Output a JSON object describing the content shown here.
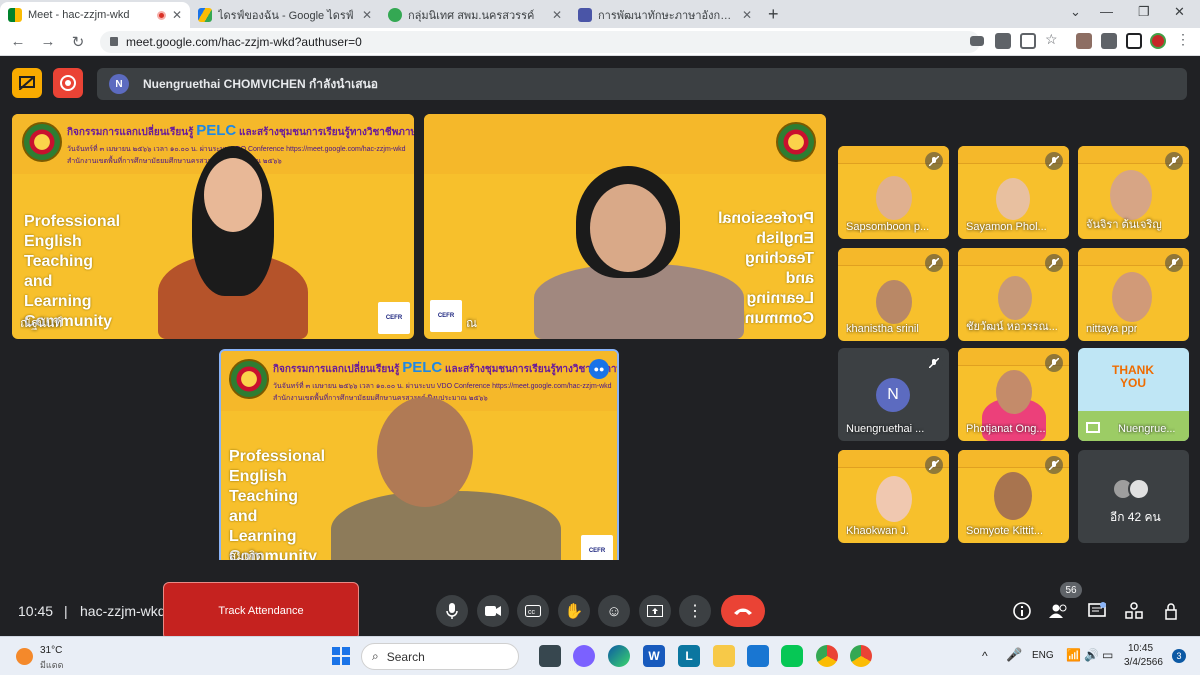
{
  "browser": {
    "tabs": [
      {
        "title": "Meet - hac-zzjm-wkd",
        "active": true,
        "recording": true,
        "favicon": "google-meet-icon"
      },
      {
        "title": "ไดรฟ์ของฉัน - Google ไดรฟ์",
        "active": false,
        "favicon": "google-drive-icon"
      },
      {
        "title": "กลุ่มนิเทศ สพม.นครสวรรค์",
        "active": false,
        "favicon": "web-icon"
      },
      {
        "title": "การพัฒนาทักษะภาษาอังกฤษ English",
        "active": false,
        "favicon": "google-forms-icon"
      }
    ],
    "url": "meet.google.com/hac-zzjm-wkd?authuser=0"
  },
  "meet": {
    "presenter_initial": "N",
    "presenter_text": "Nuengruethai CHOMVICHEN กำลังนำเสนอ",
    "banner": {
      "title_prefix": "กิจกรรมการแลกเปลี่ยนเรียนรู้",
      "pelc": "PELC",
      "title_suffix": "และสร้างชุมชนการเรียนรู้ทางวิชาชีพภาษาอังกฤษ",
      "line2": "วันจันทร์ที่ ๓ เมษายน ๒๕๖๖ เวลา ๑๐.๐๐ น. ผ่านระบบ VDO Conference https://meet.google.com/hac-zzjm-wkd",
      "line3": "สำนักงานเขตพื้นที่การศึกษามัธยมศึกษานครสวรรค์ ปีงบประมาณ ๒๕๖๖"
    },
    "pelc_text": "Professional\nEnglish\nTeaching\nand\nLearning\nCommunity",
    "cefr": "CEFR",
    "main_tiles": [
      {
        "name": "ณัฐนันท์",
        "speaking": false
      },
      {
        "name": "ณ",
        "speaking": false
      },
      {
        "name": "สมเกิด",
        "speaking": true
      }
    ],
    "side_tiles": [
      {
        "name": "Sapsomboon p..."
      },
      {
        "name": "Sayamon Phol..."
      },
      {
        "name": "จันจิรา ต้นเจริญ"
      },
      {
        "name": "khanistha srinil"
      },
      {
        "name": "ชัยวัฒน์ หอวรรณ..."
      },
      {
        "name": "nittaya ppr"
      },
      {
        "name": "Nuengruethai ...",
        "initial": "N"
      },
      {
        "name": "Photjanat Ong..."
      },
      {
        "name": "Nuengrue...",
        "thank_you": "THANK YOU"
      },
      {
        "name": "Khaokwan J."
      },
      {
        "name": "Somyote Kittit..."
      },
      {
        "name": "อีก 42 คน"
      }
    ],
    "time": "10:45",
    "meeting_code": "hac-zzjm-wkd",
    "track_attendance": "Track Attendance",
    "participants_count": "56"
  },
  "taskbar": {
    "weather_temp": "31°C",
    "weather_desc": "มีแดด",
    "search_label": "Search",
    "lang": "ENG",
    "time": "10:45",
    "date": "3/4/2566",
    "notif_count": "3"
  },
  "colors": {
    "meet_bg": "#202124",
    "slide_yellow": "#f7c02c",
    "end_call": "#ea4335",
    "track_red": "#c5221f"
  }
}
